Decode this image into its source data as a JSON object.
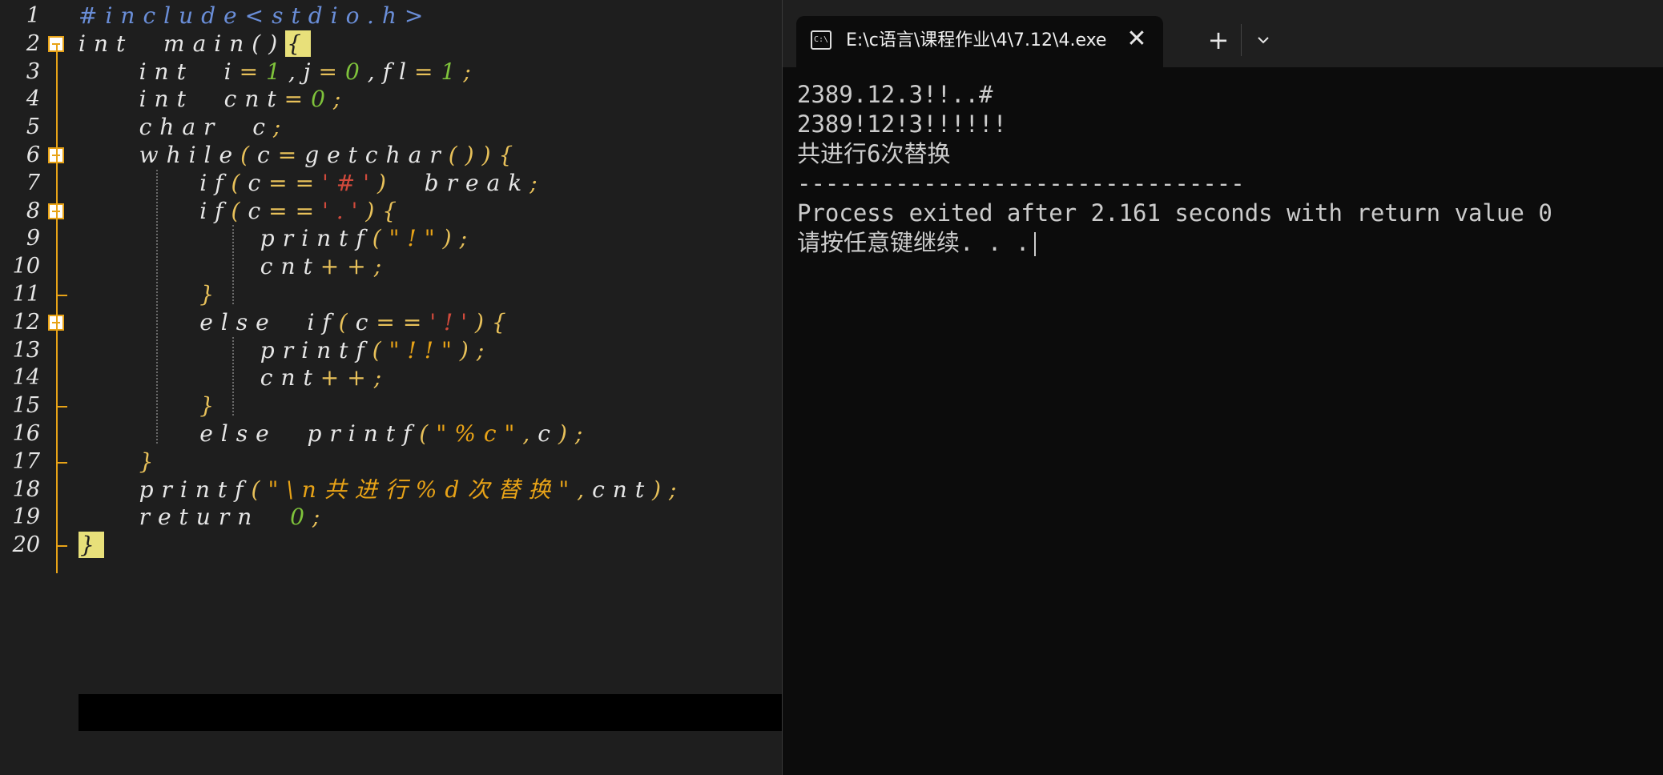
{
  "editor": {
    "line_numbers": [
      "1",
      "2",
      "3",
      "4",
      "5",
      "6",
      "7",
      "8",
      "9",
      "10",
      "11",
      "12",
      "13",
      "14",
      "15",
      "16",
      "17",
      "18",
      "19",
      "20"
    ],
    "lines": [
      [
        {
          "t": "#include<stdio.h>",
          "c": "pp"
        }
      ],
      [
        {
          "t": "int  main()",
          "c": "kw"
        },
        {
          "t": "{",
          "c": "brace-hl"
        }
      ],
      [
        {
          "t": "    int  i",
          "c": "kw"
        },
        {
          "t": "=",
          "c": "punc"
        },
        {
          "t": "1",
          "c": "num"
        },
        {
          "t": ",j",
          "c": "kw"
        },
        {
          "t": "=",
          "c": "punc"
        },
        {
          "t": "0",
          "c": "num"
        },
        {
          "t": ",fl",
          "c": "kw"
        },
        {
          "t": "=",
          "c": "punc"
        },
        {
          "t": "1",
          "c": "num"
        },
        {
          "t": ";",
          "c": "punc"
        }
      ],
      [
        {
          "t": "    int  cnt",
          "c": "kw"
        },
        {
          "t": "=",
          "c": "punc"
        },
        {
          "t": "0",
          "c": "num"
        },
        {
          "t": ";",
          "c": "punc"
        }
      ],
      [
        {
          "t": "    char  c",
          "c": "kw"
        },
        {
          "t": ";",
          "c": "punc"
        }
      ],
      [
        {
          "t": "    while",
          "c": "kw"
        },
        {
          "t": "(",
          "c": "punc"
        },
        {
          "t": "c",
          "c": "kw"
        },
        {
          "t": "=",
          "c": "punc"
        },
        {
          "t": "getchar",
          "c": "kw"
        },
        {
          "t": "()){",
          "c": "punc"
        }
      ],
      [
        {
          "t": "        if",
          "c": "kw"
        },
        {
          "t": "(",
          "c": "punc"
        },
        {
          "t": "c",
          "c": "kw"
        },
        {
          "t": "==",
          "c": "punc"
        },
        {
          "t": "'#'",
          "c": "chr"
        },
        {
          "t": ")  ",
          "c": "punc"
        },
        {
          "t": "break",
          "c": "kw"
        },
        {
          "t": ";",
          "c": "punc"
        }
      ],
      [
        {
          "t": "        if",
          "c": "kw"
        },
        {
          "t": "(",
          "c": "punc"
        },
        {
          "t": "c",
          "c": "kw"
        },
        {
          "t": "==",
          "c": "punc"
        },
        {
          "t": "'.'",
          "c": "chr"
        },
        {
          "t": "){",
          "c": "punc"
        }
      ],
      [
        {
          "t": "            printf",
          "c": "kw"
        },
        {
          "t": "(",
          "c": "punc"
        },
        {
          "t": "\"!\"",
          "c": "str"
        },
        {
          "t": ");",
          "c": "punc"
        }
      ],
      [
        {
          "t": "            cnt",
          "c": "kw"
        },
        {
          "t": "++;",
          "c": "punc"
        }
      ],
      [
        {
          "t": "        }",
          "c": "punc"
        }
      ],
      [
        {
          "t": "        else  if",
          "c": "kw"
        },
        {
          "t": "(",
          "c": "punc"
        },
        {
          "t": "c",
          "c": "kw"
        },
        {
          "t": "==",
          "c": "punc"
        },
        {
          "t": "'!'",
          "c": "chr"
        },
        {
          "t": "){",
          "c": "punc"
        }
      ],
      [
        {
          "t": "            printf",
          "c": "kw"
        },
        {
          "t": "(",
          "c": "punc"
        },
        {
          "t": "\"!!\"",
          "c": "str"
        },
        {
          "t": ");",
          "c": "punc"
        }
      ],
      [
        {
          "t": "            cnt",
          "c": "kw"
        },
        {
          "t": "++;",
          "c": "punc"
        }
      ],
      [
        {
          "t": "        }",
          "c": "punc"
        }
      ],
      [
        {
          "t": "        else  printf",
          "c": "kw"
        },
        {
          "t": "(",
          "c": "punc"
        },
        {
          "t": "\"%c\"",
          "c": "str"
        },
        {
          "t": ",",
          "c": "punc"
        },
        {
          "t": "c",
          "c": "kw"
        },
        {
          "t": ");",
          "c": "punc"
        }
      ],
      [
        {
          "t": "    }",
          "c": "punc"
        }
      ],
      [
        {
          "t": "    printf",
          "c": "kw"
        },
        {
          "t": "(",
          "c": "punc"
        },
        {
          "t": "\"\\n共进行%d次替换\"",
          "c": "str"
        },
        {
          "t": ",",
          "c": "punc"
        },
        {
          "t": "cnt",
          "c": "kw"
        },
        {
          "t": ");",
          "c": "punc"
        }
      ],
      [
        {
          "t": "    return  ",
          "c": "kw"
        },
        {
          "t": "0",
          "c": "num"
        },
        {
          "t": ";",
          "c": "punc"
        }
      ],
      [
        {
          "t": "}",
          "c": "brace-hl"
        }
      ]
    ]
  },
  "terminal": {
    "tab_title": "E:\\c语言\\课程作业\\4\\7.12\\4.exe",
    "tab_icon_text": "C:\\",
    "close_glyph": "✕",
    "new_tab_glyph": "+",
    "lines": [
      "2389.12.3!!..#",
      "2389!12!3!!!!!!",
      "共进行6次替换",
      "--------------------------------",
      "Process exited after 2.161 seconds with return value 0",
      "请按任意键继续. . ."
    ]
  },
  "colors": {
    "editor_bg": "#1e1e1e",
    "terminal_bg": "#0c0c0c",
    "fold_marker": "#e8a317",
    "string": "#e8a317",
    "number": "#7fc33b",
    "preprocessor": "#6a8ed8",
    "char_literal": "#d14a3c"
  }
}
